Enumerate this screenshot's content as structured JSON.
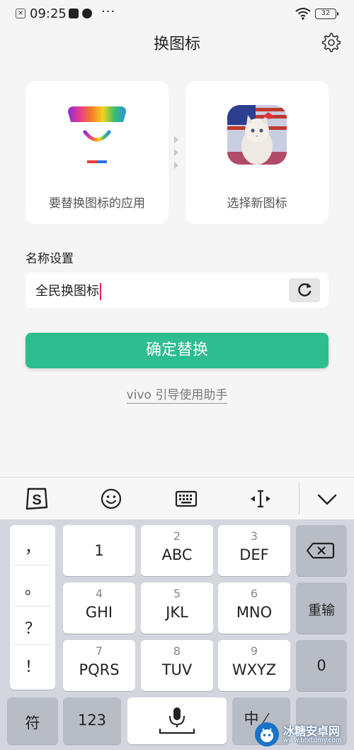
{
  "status_bar": {
    "time": "09:25",
    "battery": "32",
    "dots": "···"
  },
  "header": {
    "title": "换图标"
  },
  "cards": {
    "source_label": "要替换图标的应用",
    "target_label": "选择新图标"
  },
  "name_setting": {
    "label": "名称设置",
    "value": "全民换图标"
  },
  "confirm_label": "确定替换",
  "help_link": "vivo 引导使用助手",
  "keyboard": {
    "punctuation": [
      "，",
      "。",
      "？",
      "！"
    ],
    "keys": [
      {
        "num": "",
        "main": "1"
      },
      {
        "num": "2",
        "main": "ABC"
      },
      {
        "num": "3",
        "main": "DEF"
      },
      {
        "num": "4",
        "main": "GHI"
      },
      {
        "num": "5",
        "main": "JKL"
      },
      {
        "num": "6",
        "main": "MNO"
      },
      {
        "num": "7",
        "main": "PQRS"
      },
      {
        "num": "8",
        "main": "TUV"
      },
      {
        "num": "9",
        "main": "WXYZ"
      }
    ],
    "retype": "重输",
    "zero": "0",
    "symbols": "符",
    "numbers": "123",
    "lang": "中"
  },
  "watermark": {
    "text": "冰糖安卓网",
    "url": "www.btxtdmy.com"
  },
  "colors": {
    "accent": "#2dbd8e",
    "caret": "#e0245e"
  }
}
